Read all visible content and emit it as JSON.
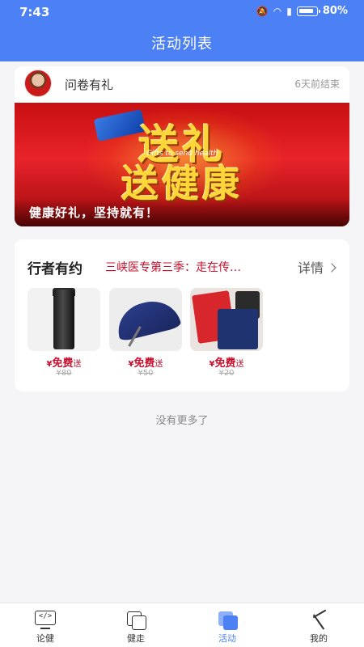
{
  "status_bar": {
    "time": "7:43",
    "battery": "80%"
  },
  "header": {
    "title": "活动列表"
  },
  "activity1": {
    "title": "问卷有礼",
    "time_note": "6天前结束",
    "banner_text_line1": "送礼",
    "banner_text_line2": "送健康",
    "banner_eng": "Gifts to send health",
    "banner_caption": "健康好礼，坚持就有！"
  },
  "activity2": {
    "title": "行者有约",
    "subtitle": "三峡医专第三季：走在传…",
    "detail_label": "详情",
    "products": [
      {
        "icon": "thermos-cup-image",
        "price_prefix": "¥",
        "price": "免费",
        "suffix": "送",
        "original": "¥80"
      },
      {
        "icon": "umbrella-image",
        "price_prefix": "¥",
        "price": "免费",
        "suffix": "送",
        "original": "¥50"
      },
      {
        "icon": "notebook-image",
        "price_prefix": "¥",
        "price": "免费",
        "suffix": "送",
        "original": "¥20"
      }
    ]
  },
  "footer_note": "没有更多了",
  "tabbar": {
    "items": [
      {
        "label": "论健",
        "icon": "monitor-code-icon"
      },
      {
        "label": "健走",
        "icon": "squares-icon"
      },
      {
        "label": "活动",
        "icon": "squares-filled-icon"
      },
      {
        "label": "我的",
        "icon": "tool-icon"
      }
    ],
    "active_index": 2,
    "active_color": "#4c80f5"
  },
  "colors": {
    "header_bg": "#4c80f5",
    "accent_red": "#c8102e"
  }
}
